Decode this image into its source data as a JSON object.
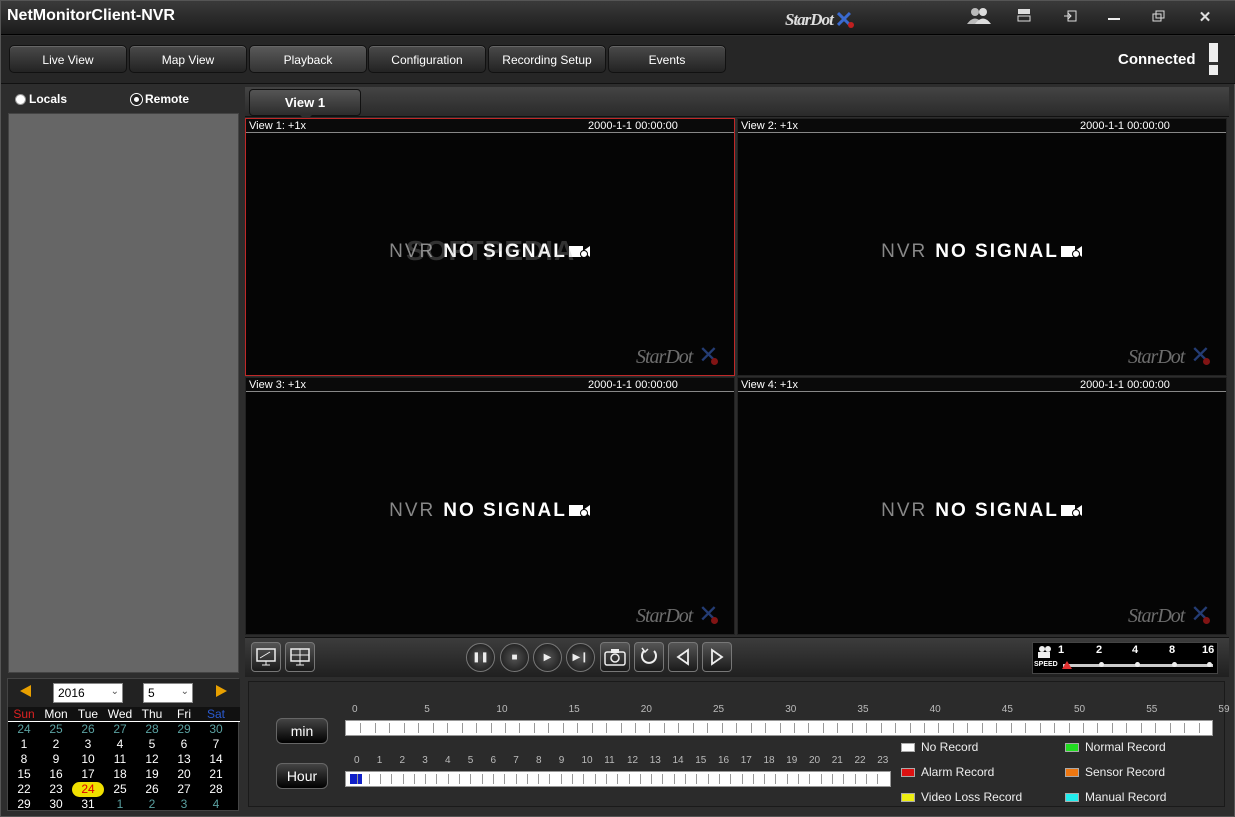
{
  "window": {
    "title": "NetMonitorClient-NVR",
    "brand": "StarDot",
    "buttons": [
      "users-icon",
      "layout-icon",
      "login-icon",
      "minimize-icon",
      "restore-icon",
      "close-icon"
    ]
  },
  "nav": {
    "tabs": [
      "Live View",
      "Map View",
      "Playback",
      "Configuration",
      "Recording Setup",
      "Events"
    ],
    "active": "Playback",
    "status": "Connected"
  },
  "source": {
    "locals_label": "Locals",
    "remote_label": "Remote",
    "selected": "Remote"
  },
  "calendar": {
    "year": "2016",
    "month": "5",
    "weekdays": [
      "Sun",
      "Mon",
      "Tue",
      "Wed",
      "Thu",
      "Fri",
      "Sat"
    ],
    "weeks": [
      [
        "24",
        "25",
        "26",
        "27",
        "28",
        "29",
        "30"
      ],
      [
        "1",
        "2",
        "3",
        "4",
        "5",
        "6",
        "7"
      ],
      [
        "8",
        "9",
        "10",
        "11",
        "12",
        "13",
        "14"
      ],
      [
        "15",
        "16",
        "17",
        "18",
        "19",
        "20",
        "21"
      ],
      [
        "22",
        "23",
        "24",
        "25",
        "26",
        "27",
        "28"
      ],
      [
        "29",
        "30",
        "31",
        "1",
        "2",
        "3",
        "4"
      ]
    ],
    "today": "24"
  },
  "views": {
    "tab_label": "View 1",
    "panes": [
      {
        "label": "View 1:  +1x",
        "time": "2000-1-1 00:00:00",
        "nvr": "NVR",
        "status": "NO SIGNAL",
        "watermark": "StarDot"
      },
      {
        "label": "View 2:  +1x",
        "time": "2000-1-1 00:00:00",
        "nvr": "NVR",
        "status": "NO SIGNAL",
        "watermark": "StarDot"
      },
      {
        "label": "View 3:  +1x",
        "time": "2000-1-1 00:00:00",
        "nvr": "NVR",
        "status": "NO SIGNAL",
        "watermark": "StarDot"
      },
      {
        "label": "View 4:  +1x",
        "time": "2000-1-1 00:00:00",
        "nvr": "NVR",
        "status": "NO SIGNAL",
        "watermark": "StarDot"
      }
    ],
    "overlay_watermark": "SOFTPEDIA"
  },
  "controls": {
    "speed_label": "SPEED",
    "speeds": [
      "1",
      "2",
      "4",
      "8",
      "16"
    ],
    "current_speed": "1"
  },
  "timeline": {
    "min_label": "min",
    "hour_label": "Hour",
    "min_ticks": [
      "0",
      "5",
      "10",
      "15",
      "20",
      "25",
      "30",
      "35",
      "40",
      "45",
      "50",
      "55",
      "59"
    ],
    "hour_ticks": [
      "0",
      "1",
      "2",
      "3",
      "4",
      "5",
      "6",
      "7",
      "8",
      "9",
      "10",
      "11",
      "12",
      "13",
      "14",
      "15",
      "16",
      "17",
      "18",
      "19",
      "20",
      "21",
      "22",
      "23"
    ],
    "legend": [
      {
        "label": "No Record",
        "color": "#ffffff"
      },
      {
        "label": "Normal Record",
        "color": "#22dd22"
      },
      {
        "label": "Alarm Record",
        "color": "#dd1111"
      },
      {
        "label": "Sensor Record",
        "color": "#ee7711"
      },
      {
        "label": "Video Loss Record",
        "color": "#eeee11"
      },
      {
        "label": "Manual Record",
        "color": "#22eeee"
      }
    ]
  }
}
